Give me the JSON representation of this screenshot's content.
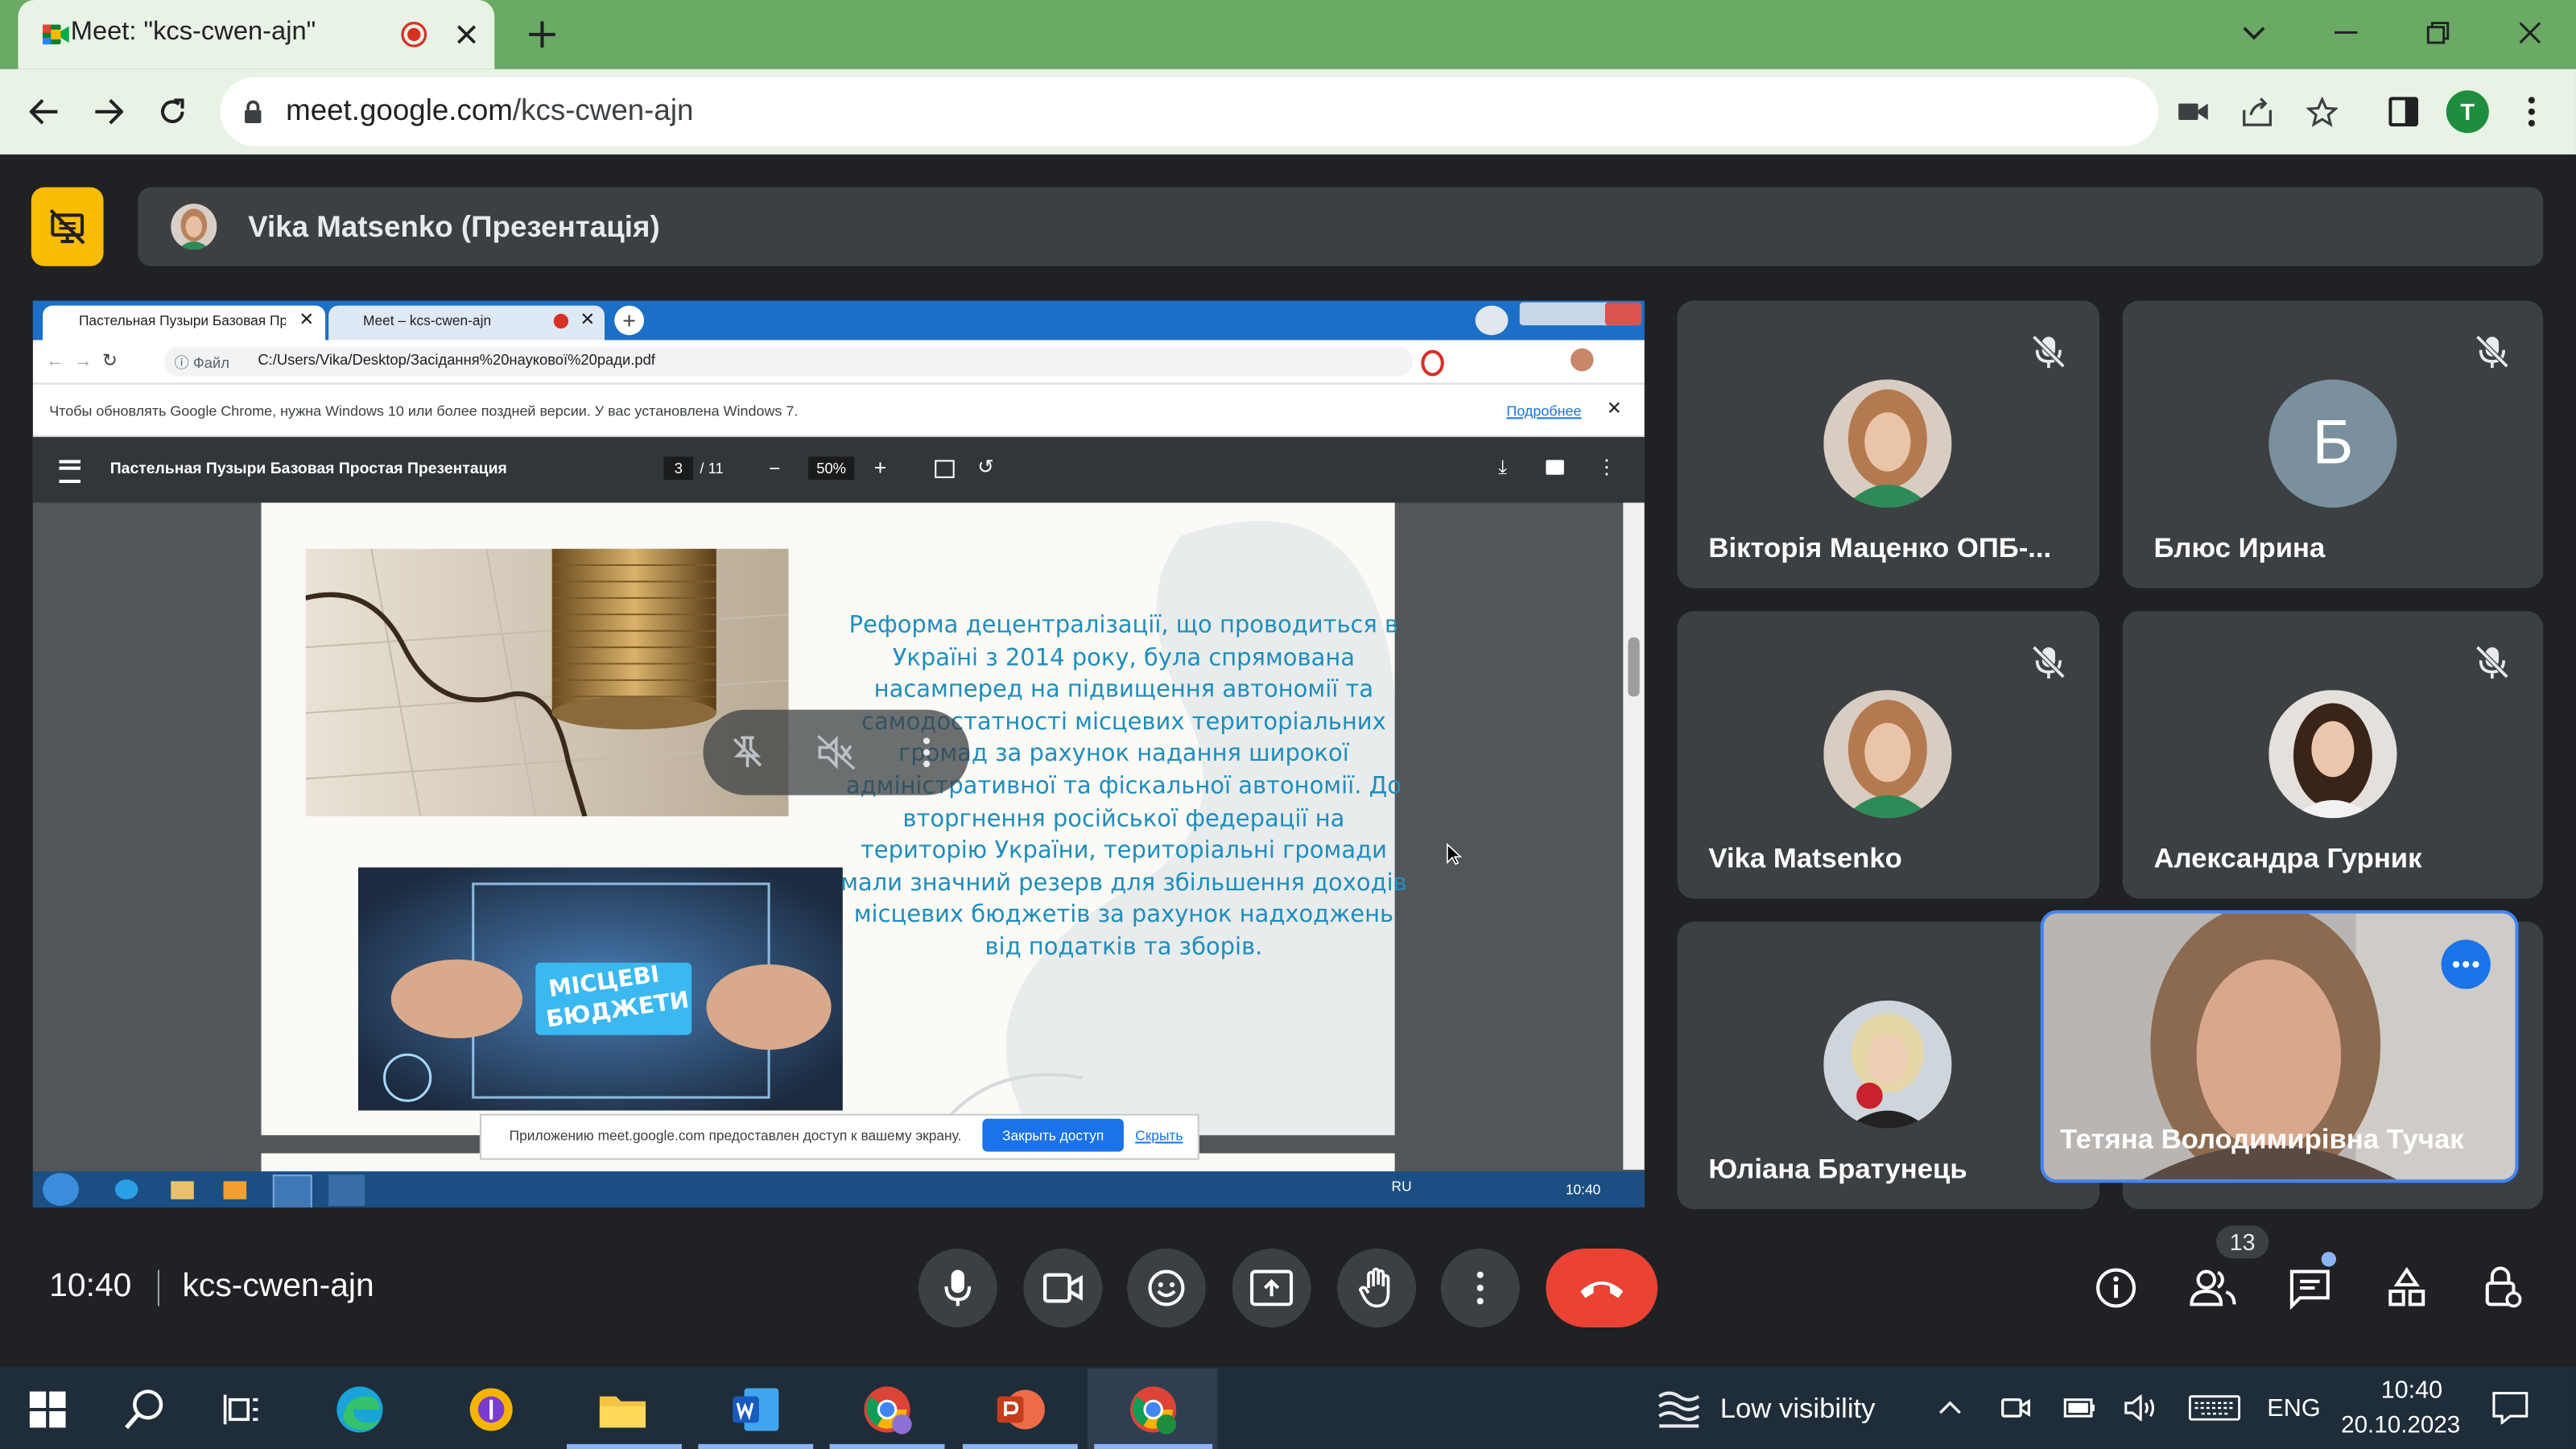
{
  "browser": {
    "tab_title": "Meet: \"kcs-cwen-ajn\"",
    "url_host": "meet.google.com",
    "url_path": "/kcs-cwen-ajn",
    "profile_initial": "T",
    "colors": {
      "tabstrip": "#6aaa64",
      "toolbar": "#e8f2e5",
      "profile": "#1e8e3e"
    }
  },
  "presentation": {
    "title": "Vika Matsenko (Презентація)"
  },
  "shared_screen": {
    "tabs": [
      "Пастельная Пузыри Базовая Пр",
      "Meet – kcs-cwen-ajn"
    ],
    "file_label": "Файл",
    "path": "C:/Users/Vika/Desktop/Засідання%20наукової%20ради.pdf",
    "notice": "Чтобы обновлять Google Chrome, нужна Windows 10 или более поздней версии. У вас установлена Windows 7.",
    "notice_link": "Подробнее",
    "pdf_title": "Пастельная Пузыри Базовая Простая Презентация",
    "page_current": "3",
    "page_total": "/ 11",
    "zoom": "50%",
    "slide_text": "Реформа децентралізації, що проводиться в Україні з 2014 року, була спрямована насамперед на підвищення автономії та самодостатності місцевих територіальних громад за рахунок надання широкої адміністративної та фіскальної автономії. До вторгнення російської федерації на територію України, територіальні громади мали значний резерв для збільшення доходів місцевих бюджетів за рахунок надходжень від податків та зборів.",
    "image_caption": "МІСЦЕВІ БЮДЖЕТИ",
    "share_notice": "Приложению meet.google.com предоставлен доступ к вашему экрану.",
    "stop_share": "Закрыть доступ",
    "hide": "Скрыть",
    "tray_lang": "RU",
    "tray_time": "10:40"
  },
  "participants": [
    {
      "name": "Вікторія Маценко ОПБ-...",
      "muted": true
    },
    {
      "name": "Блюс Ирина",
      "initial": "Б",
      "muted": true
    },
    {
      "name": "Vika Matsenko",
      "muted": true
    },
    {
      "name": "Александра Гурник",
      "muted": true
    },
    {
      "name": "Юліана Братунець",
      "muted": true
    },
    {
      "name": "Тетяна Володимирівна Тучак",
      "self_view": true
    }
  ],
  "meeting": {
    "time": "10:40",
    "code": "kcs-cwen-ajn",
    "participant_count": "13"
  },
  "taskbar": {
    "weather": "Low visibility",
    "lang": "ENG",
    "time": "10:40",
    "date": "20.10.2023"
  }
}
